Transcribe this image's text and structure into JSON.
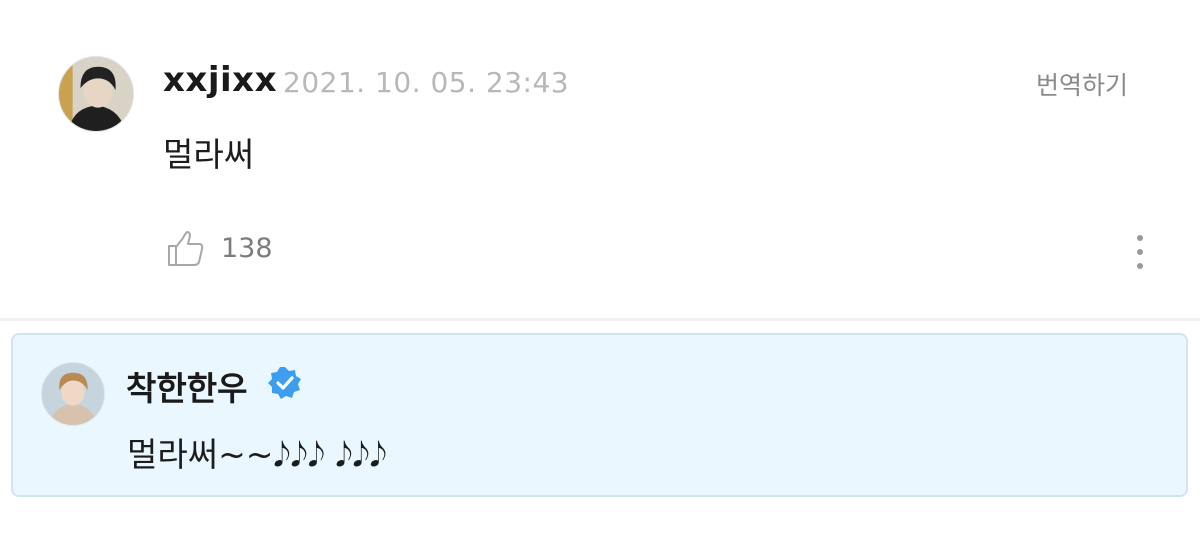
{
  "comment": {
    "username": "xxjixx",
    "timestamp": "2021. 10. 05. 23:43",
    "translate_label": "번역하기",
    "text": "멀라써",
    "like_count": "138"
  },
  "reply": {
    "username": "착한한우",
    "verified": true,
    "text": "멀라써~~𝅘𝅥𝅮𝅘𝅥𝅮𝅘𝅥𝅮 𝅘𝅥𝅮𝅘𝅥𝅮𝅘𝅥𝅮"
  },
  "icons": {
    "like": "thumbs-up-icon",
    "more": "more-vertical-icon",
    "verified": "verified-badge-icon"
  },
  "colors": {
    "reply_background": "#eaf7fe",
    "reply_border": "#cfe5f1",
    "verified_badge": "#3d9ef0",
    "timestamp": "#b8b8b8"
  }
}
